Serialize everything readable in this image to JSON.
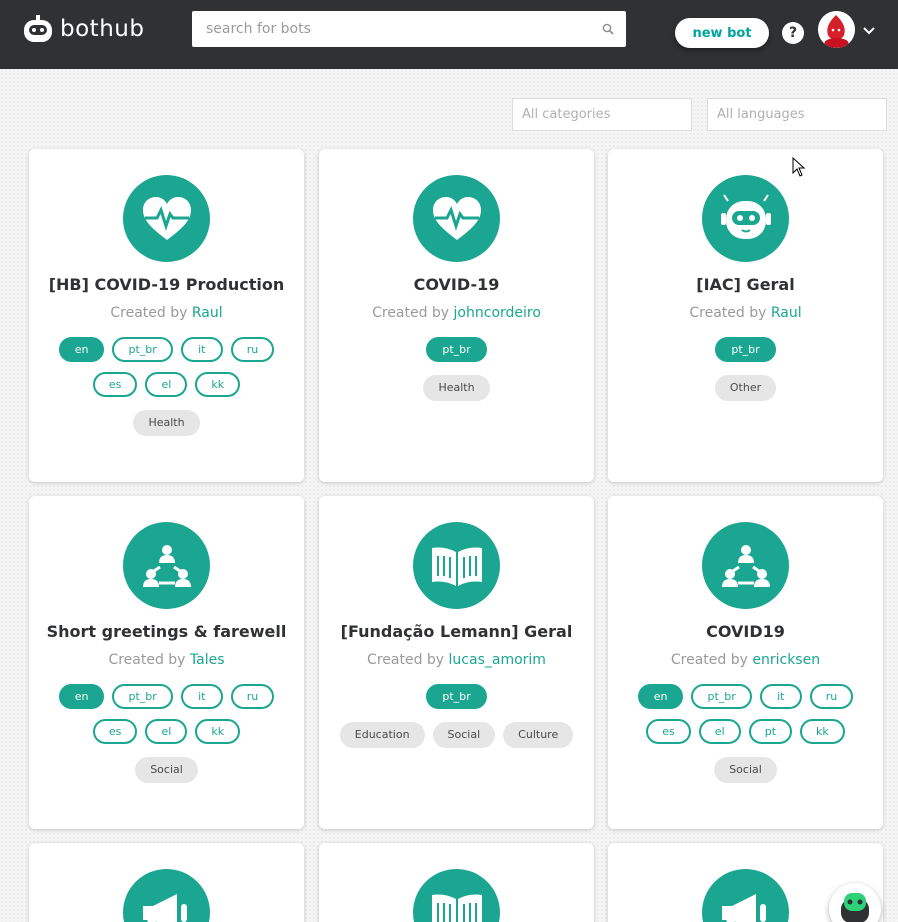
{
  "header": {
    "logo_text": "bothub",
    "search_placeholder": "search for bots",
    "new_bot_label": "new bot",
    "help_label": "?"
  },
  "filters": {
    "categories_placeholder": "All categories",
    "languages_placeholder": "All languages"
  },
  "created_by_prefix": "Created by",
  "cards": [
    {
      "icon": "heart-pulse-icon",
      "title": "[HB] COVID-19 Production",
      "author": "Raul",
      "languages": [
        [
          "en",
          "pt_br",
          "it",
          "ru"
        ],
        [
          "es",
          "el",
          "kk"
        ]
      ],
      "active_language": "en",
      "categories": [
        "Health"
      ]
    },
    {
      "icon": "heart-pulse-icon",
      "title": "COVID-19",
      "author": "johncordeiro",
      "languages": [
        [
          "pt_br"
        ]
      ],
      "active_language": "pt_br",
      "categories": [
        "Health"
      ]
    },
    {
      "icon": "robot-icon",
      "title": "[IAC] Geral",
      "author": "Raul",
      "languages": [
        [
          "pt_br"
        ]
      ],
      "active_language": "pt_br",
      "categories": [
        "Other"
      ]
    },
    {
      "icon": "people-network-icon",
      "title": "Short greetings & farewell",
      "author": "Tales",
      "languages": [
        [
          "en",
          "pt_br",
          "it",
          "ru"
        ],
        [
          "es",
          "el",
          "kk"
        ]
      ],
      "active_language": "en",
      "categories": [
        "Social"
      ]
    },
    {
      "icon": "open-book-icon",
      "title": "[Fundação Lemann] Geral",
      "author": "lucas_amorim",
      "languages": [
        [
          "pt_br"
        ]
      ],
      "active_language": "pt_br",
      "categories": [
        "Education",
        "Social",
        "Culture"
      ]
    },
    {
      "icon": "people-network-icon",
      "title": "COVID19",
      "author": "enricksen",
      "languages": [
        [
          "en",
          "pt_br",
          "it",
          "ru"
        ],
        [
          "es",
          "el",
          "pt",
          "kk"
        ]
      ],
      "active_language": "en",
      "categories": [
        "Social"
      ]
    },
    {
      "icon": "megaphone-icon",
      "title": "",
      "author": "",
      "languages": [],
      "active_language": "",
      "categories": []
    },
    {
      "icon": "open-book-icon",
      "title": "",
      "author": "",
      "languages": [],
      "active_language": "",
      "categories": []
    },
    {
      "icon": "megaphone-icon",
      "title": "",
      "author": "",
      "languages": [],
      "active_language": "",
      "categories": []
    }
  ],
  "colors": {
    "header_bg": "#2f3133",
    "accent": "#1aa690",
    "category_bg": "#e6e6e6"
  }
}
